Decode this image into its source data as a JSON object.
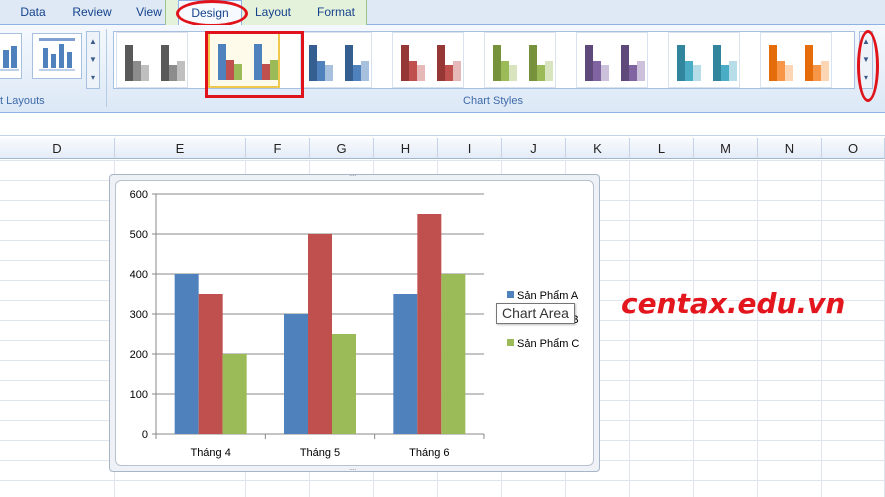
{
  "ribbon": {
    "tabs": [
      {
        "label": "Data"
      },
      {
        "label": "Review"
      },
      {
        "label": "View"
      },
      {
        "label": "Design"
      },
      {
        "label": "Layout"
      },
      {
        "label": "Format"
      }
    ],
    "active_tab": "Design",
    "groups": {
      "chart_layouts_label": "t Layouts",
      "chart_styles_label": "Chart Styles"
    },
    "style_palettes": [
      [
        "#595959",
        "#8c8c8c",
        "#bfbfbf"
      ],
      [
        "#595959",
        "#8c8c8c",
        "#bfbfbf"
      ],
      [
        "#4f81bd",
        "#c0504d",
        "#9bbb59"
      ],
      [
        "#4f81bd",
        "#c0504d",
        "#9bbb59"
      ],
      [
        "#365f91",
        "#4f81bd",
        "#a7c0de"
      ],
      [
        "#365f91",
        "#4f81bd",
        "#a7c0de"
      ],
      [
        "#953735",
        "#c0504d",
        "#e6b9b8"
      ],
      [
        "#953735",
        "#c0504d",
        "#e6b9b8"
      ],
      [
        "#76923c",
        "#9bbb59",
        "#d7e4bd"
      ],
      [
        "#76923c",
        "#9bbb59",
        "#d7e4bd"
      ],
      [
        "#5f497a",
        "#8064a2",
        "#ccc1da"
      ],
      [
        "#5f497a",
        "#8064a2",
        "#ccc1da"
      ],
      [
        "#31859c",
        "#4bacc6",
        "#b7dee8"
      ],
      [
        "#31859c",
        "#4bacc6",
        "#b7dee8"
      ],
      [
        "#e46c0a",
        "#f79646",
        "#fcd5b5"
      ],
      [
        "#e46c0a",
        "#f79646",
        "#fcd5b5"
      ]
    ],
    "highlight_color": "#e0121a"
  },
  "sheet": {
    "columns": [
      "D",
      "E",
      "F",
      "G",
      "H",
      "I",
      "J",
      "K",
      "L",
      "M",
      "N",
      "O"
    ]
  },
  "chart_data": {
    "type": "bar",
    "categories": [
      "Tháng 4",
      "Tháng 5",
      "Tháng 6"
    ],
    "series": [
      {
        "name": "Sản Phẩm A",
        "values": [
          400,
          300,
          350
        ],
        "color": "#4f81bd"
      },
      {
        "name": "Sản Phẩm B",
        "values": [
          350,
          500,
          550
        ],
        "color": "#c0504d"
      },
      {
        "name": "Sản Phẩm C",
        "values": [
          200,
          250,
          400
        ],
        "color": "#9bbb59"
      }
    ],
    "ylim": [
      0,
      600
    ],
    "yticks": [
      0,
      100,
      200,
      300,
      400,
      500,
      600
    ],
    "grid": true,
    "legend": "right"
  },
  "tooltip": {
    "text": "Chart Area"
  },
  "watermark": {
    "text": "centax.edu.vn",
    "color": "#e3151d"
  }
}
